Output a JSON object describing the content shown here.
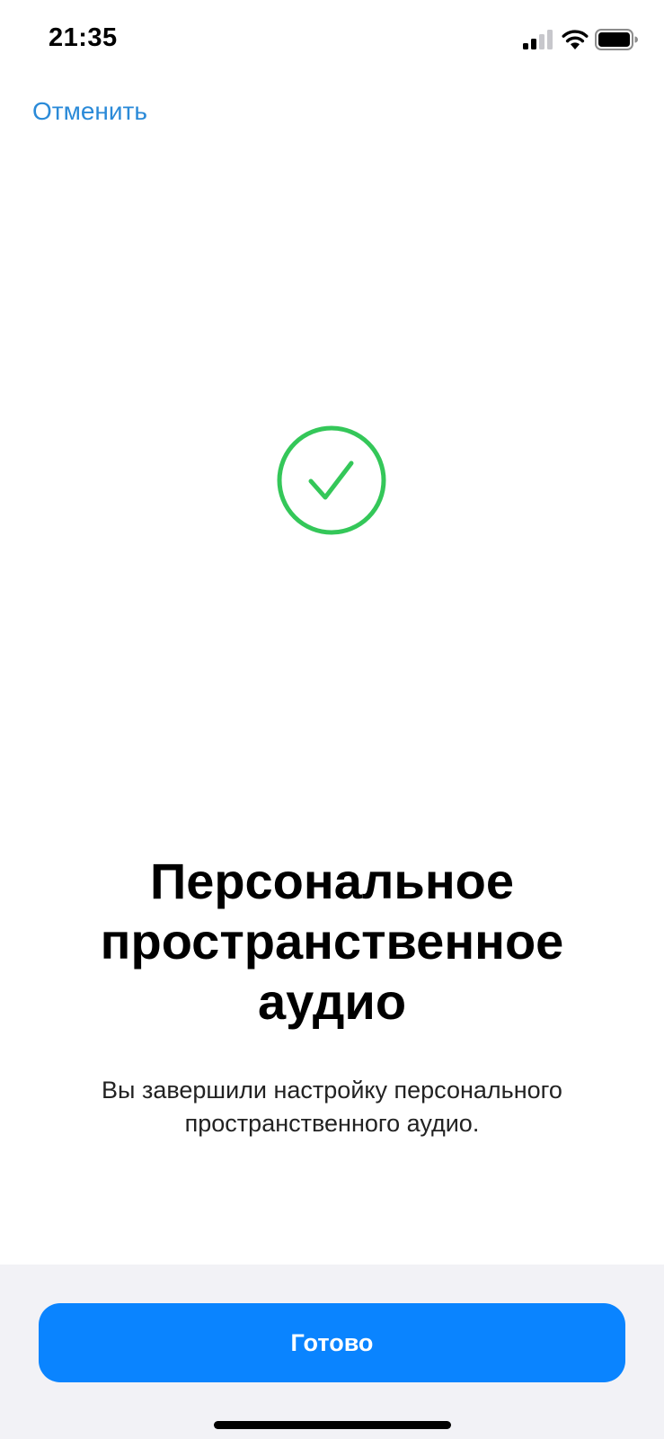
{
  "status_bar": {
    "time": "21:35",
    "icons": [
      "cellular-signal-icon",
      "wifi-icon",
      "battery-icon"
    ]
  },
  "nav": {
    "cancel_label": "Отменить"
  },
  "success_icon": "checkmark-circle-icon",
  "content": {
    "title": "Персональное пространственное аудио",
    "subtitle": "Вы завершили настройку персонального пространственного аудио."
  },
  "footer": {
    "done_label": "Готово"
  },
  "colors": {
    "accent": "#0a84ff",
    "link": "#2a8ad8",
    "success": "#34c759",
    "footer_background": "#f2f2f6"
  }
}
